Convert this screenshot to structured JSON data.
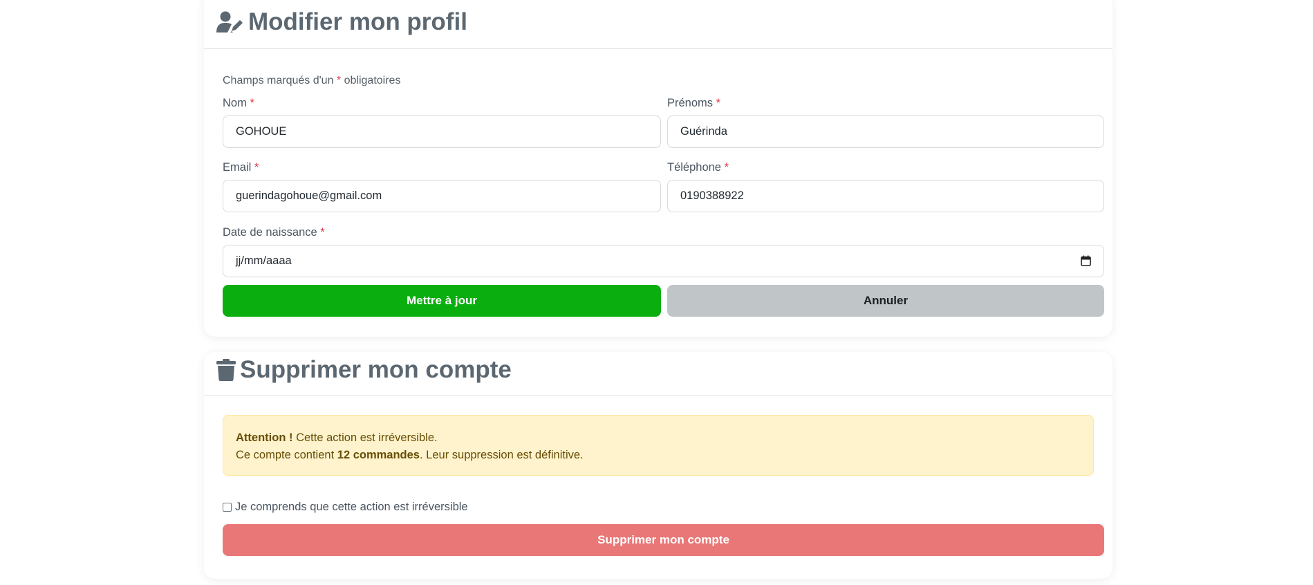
{
  "profile": {
    "title": "Modifier mon profil",
    "title_icon": "user-pen-icon",
    "required_note_prefix": "Champs marqués d'un",
    "required_star": "*",
    "required_note_suffix": "obligatoires",
    "fields": {
      "nom": {
        "label": "Nom",
        "value": "GOHOUE"
      },
      "prenoms": {
        "label": "Prénoms",
        "value": "Guérinda"
      },
      "email": {
        "label": "Email",
        "value": "guerindagohoue@gmail.com"
      },
      "telephone": {
        "label": "Téléphone",
        "value": "0190388922"
      },
      "naissance": {
        "label": "Date de naissance",
        "value": "jj/mm/aaaa",
        "icon": "calendar-icon"
      }
    },
    "update_label": "Mettre à jour",
    "cancel_label": "Annuler"
  },
  "delete": {
    "title": "Supprimer mon compte",
    "title_icon": "trash-icon",
    "alert_strong": "Attention !",
    "alert_line1": "Cette action est irréversible.",
    "alert_line2_prefix": "Ce compte contient",
    "alert_line2_count": "12 commandes",
    "alert_line2_suffix": ". Leur suppression est définitive.",
    "confirm_label": "Je comprends que cette action est irréversible",
    "delete_label": "Supprimer mon compte"
  },
  "colors": {
    "update_button": "#0aae0f",
    "cancel_button": "#c0c5c7",
    "delete_button": "#e97777",
    "required_star": "#dc3545",
    "alert_bg": "#fff3cd"
  }
}
